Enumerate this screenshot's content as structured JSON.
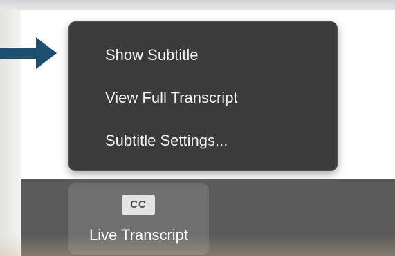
{
  "menu": {
    "items": [
      {
        "label": "Show Subtitle"
      },
      {
        "label": "View Full Transcript"
      },
      {
        "label": "Subtitle Settings..."
      }
    ]
  },
  "toolbar": {
    "live_transcript": {
      "icon_text": "CC",
      "label": "Live Transcript"
    }
  },
  "colors": {
    "arrow": "#1e4f6e",
    "menu_bg": "#3b3b3b",
    "toolbar_bg": "#5a5a5a"
  },
  "icons": {
    "arrow": "right-arrow-icon",
    "cc": "closed-caption-icon"
  }
}
